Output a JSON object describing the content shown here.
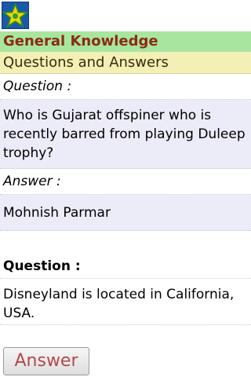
{
  "header": {
    "title": "General Knowledge",
    "subtitle": "Questions and Answers"
  },
  "card": {
    "question_label": "Question :",
    "question_text": "Who is Gujarat offspiner who is recently barred from playing Duleep trophy?",
    "answer_label": "Answer :",
    "answer_text": "Mohnish Parmar"
  },
  "next": {
    "question_label": "Question :",
    "question_text": "Disneyland is located in California, USA."
  },
  "actions": {
    "answer_button": "Answer"
  },
  "icons": {
    "logo": "star-badge-icon"
  },
  "colors": {
    "title_band": "#a8e6a0",
    "title_text": "#8b2a14",
    "subtitle_band": "#f2f0b4",
    "qa_box": "#ecebf8",
    "logo_bg": "#1c58a8",
    "star": "#f5d300"
  }
}
